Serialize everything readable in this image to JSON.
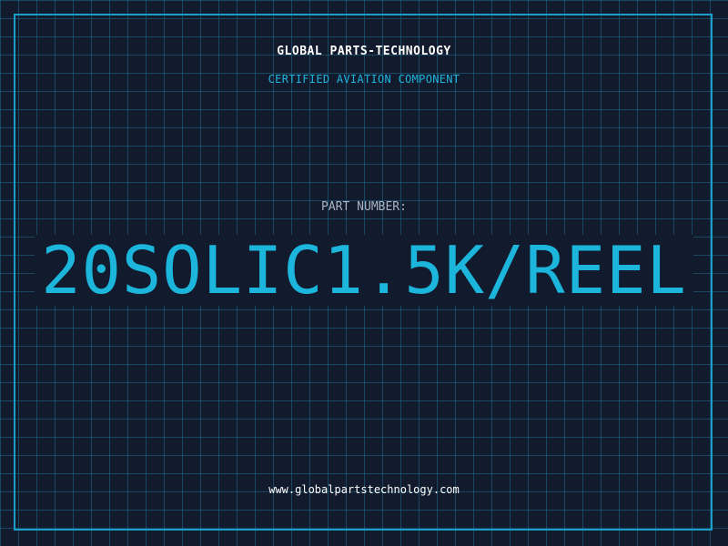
{
  "header": {
    "company": "GLOBAL PARTS-TECHNOLOGY",
    "tagline": "CERTIFIED AVIATION COMPONENT"
  },
  "part": {
    "label": "PART NUMBER:",
    "number": "20SOLIC1.5K/REEL"
  },
  "footer": {
    "website": "www.globalpartstechnology.com"
  },
  "colors": {
    "background": "#121b2e",
    "grid": "#1e6e87",
    "accent": "#1cb6dc",
    "text": "#ffffff",
    "muted": "#a9b4c6"
  }
}
